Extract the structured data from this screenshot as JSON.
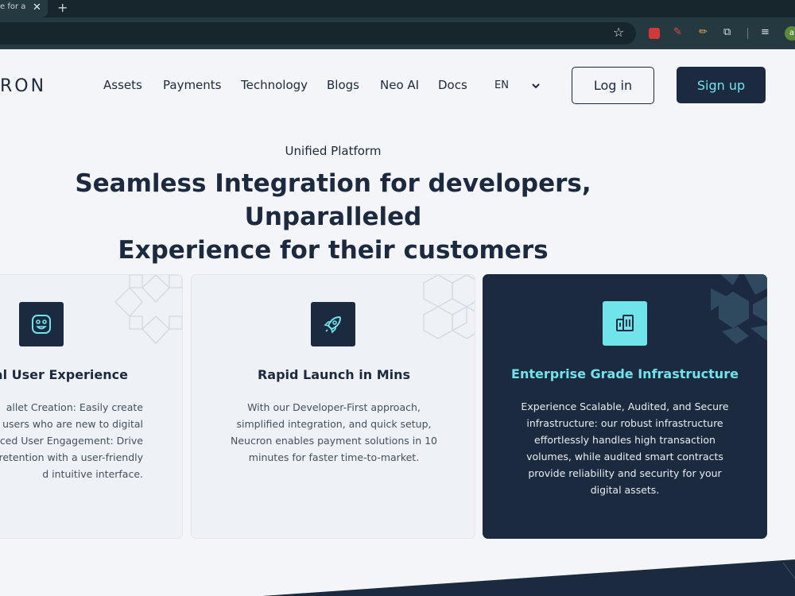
{
  "browser": {
    "tab_title": "e for a",
    "tab_close": "✕",
    "new_tab": "+",
    "bookmark_icon": "star-icon",
    "avatar_letter": "a"
  },
  "nav": {
    "logo": "RON",
    "items": [
      "Assets",
      "Payments",
      "Technology",
      "Blogs",
      "Neo AI",
      "Docs"
    ],
    "language": "EN",
    "login": "Log in",
    "signup": "Sign up"
  },
  "hero": {
    "eyebrow": "Unified Platform",
    "headline_line1": "Seamless Integration for developers, Unparalleled",
    "headline_line2": "Experience for their customers"
  },
  "cards": [
    {
      "icon": "smiley-icon",
      "title": "onal User Experience",
      "body": [
        "allet Creation: Easily create",
        "users who are new to digital",
        "nced User Engagement: Drive",
        "l retention with a user-friendly",
        "d intuitive interface."
      ]
    },
    {
      "icon": "rocket-icon",
      "title": "Rapid Launch in Mins",
      "body": [
        "With our Developer-First approach,",
        "simplified integration, and quick setup,",
        "Neucron enables payment solutions in 10",
        "minutes for faster time-to-market."
      ]
    },
    {
      "icon": "building-icon",
      "title": "Enterprise Grade Infrastructure",
      "body": [
        "Experience Scalable, Audited, and Secure",
        "infrastructure: our robust infrastructure",
        "effortlessly handles high transaction",
        "volumes, while audited smart contracts",
        "provide reliability and security for your",
        "digital assets."
      ]
    }
  ],
  "colors": {
    "navy": "#1c2a3f",
    "accent": "#6fe4ea",
    "page_bg": "#f3f5f8"
  }
}
